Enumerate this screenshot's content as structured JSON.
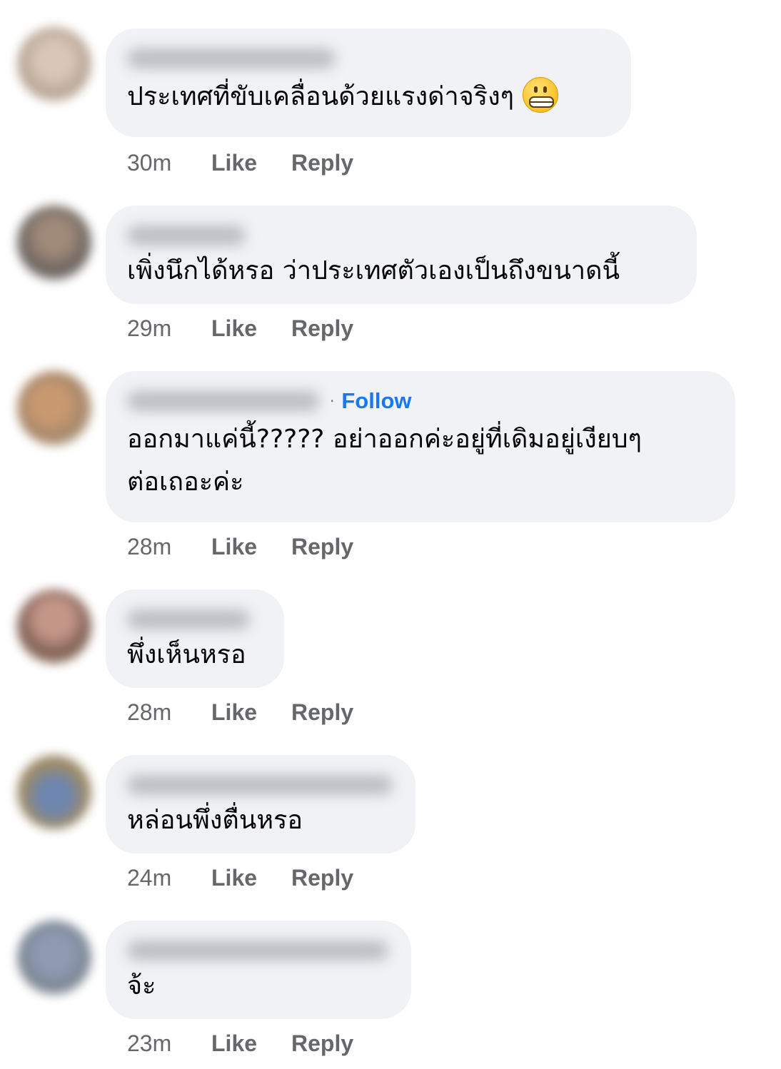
{
  "comments": [
    {
      "text_lines": [
        "ประเทศที่ขับเคลื่อนด้วยแรงด่าจริงๆ"
      ],
      "emoji": "grimacing-face-icon",
      "follow": "",
      "time": "30m",
      "like": "Like",
      "reply": "Reply",
      "avatar_color": "#c9b7a7"
    },
    {
      "text_lines": [
        "เพิ่งนึกได้หรอ ว่าประเทศตัวเองเป็นถึงขนาดนี้"
      ],
      "emoji": "",
      "follow": "",
      "time": "29m",
      "like": "Like",
      "reply": "Reply",
      "avatar_color": "#8a7d72"
    },
    {
      "text_lines": [
        "ออกมาแค่นี้????? อย่าออกค่ะอยู่ที่เดิมอยู่เงียบๆ",
        "ต่อเถอะค่ะ"
      ],
      "emoji": "",
      "follow": "Follow",
      "separator": "·",
      "time": "28m",
      "like": "Like",
      "reply": "Reply",
      "avatar_color": "#c7a07a"
    },
    {
      "text_lines": [
        "พึ่งเห็นหรอ"
      ],
      "emoji": "",
      "follow": "",
      "time": "28m",
      "like": "Like",
      "reply": "Reply",
      "avatar_color": "#a0776a"
    },
    {
      "text_lines": [
        "หล่อนพึ่งตื่นหรอ"
      ],
      "emoji": "",
      "follow": "",
      "time": "24m",
      "like": "Like",
      "reply": "Reply",
      "avatar_color": "#9c8d6d"
    },
    {
      "text_lines": [
        "จ้ะ"
      ],
      "emoji": "",
      "follow": "",
      "time": "23m",
      "like": "Like",
      "reply": "Reply",
      "avatar_color": "#9aa3ad"
    }
  ],
  "colors": {
    "bubble": "#f0f2f5",
    "text": "#050505",
    "meta": "#65676b",
    "follow": "#1877f2"
  }
}
